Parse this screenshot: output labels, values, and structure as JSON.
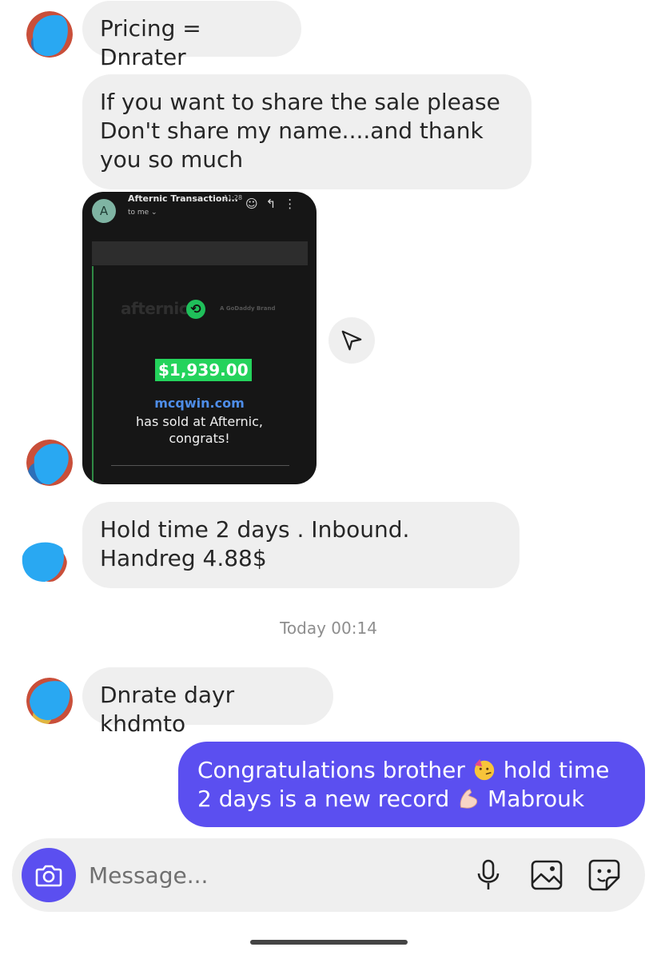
{
  "messages": [
    {
      "sender": "other",
      "text": "Pricing = Dnrater"
    },
    {
      "sender": "other",
      "text": "If you want to share the sale please Don't share my name....and thank you so much"
    },
    {
      "sender": "other",
      "type": "image",
      "email": {
        "avatar_letter": "A",
        "sender": "Afternic Transaction...",
        "time": "11:28",
        "to": "to me ⌄",
        "logo_text": "afternic",
        "godaddy_text": "A GoDaddy Brand",
        "price": "$1,939.00",
        "domain": "mcqwin.com",
        "sold_line1": "has sold at Afternic,",
        "sold_line2": "congrats!"
      }
    },
    {
      "sender": "other",
      "text": "Hold time 2 days . Inbound. Handreg 4.88$"
    },
    {
      "sender": "other",
      "text": "Dnrate dayr khdmto"
    },
    {
      "sender": "me",
      "text_part1": "Congratulations brother ",
      "emoji1": "partying-face-emoji",
      "text_part2": " hold time 2 days is a new record ",
      "emoji2": "flexed-biceps-emoji",
      "text_part3": " Mabrouk"
    }
  ],
  "timestamp": "Today 00:14",
  "composer": {
    "placeholder": "Message...",
    "icons": [
      "camera-icon",
      "microphone-icon",
      "gallery-icon",
      "sticker-icon"
    ]
  },
  "colors": {
    "accent": "#5b4ff0",
    "incoming_bubble": "#efefef",
    "avatar_blue": "#29a8f2",
    "price_green": "#24d35c",
    "domain_blue": "#4e8de8"
  }
}
